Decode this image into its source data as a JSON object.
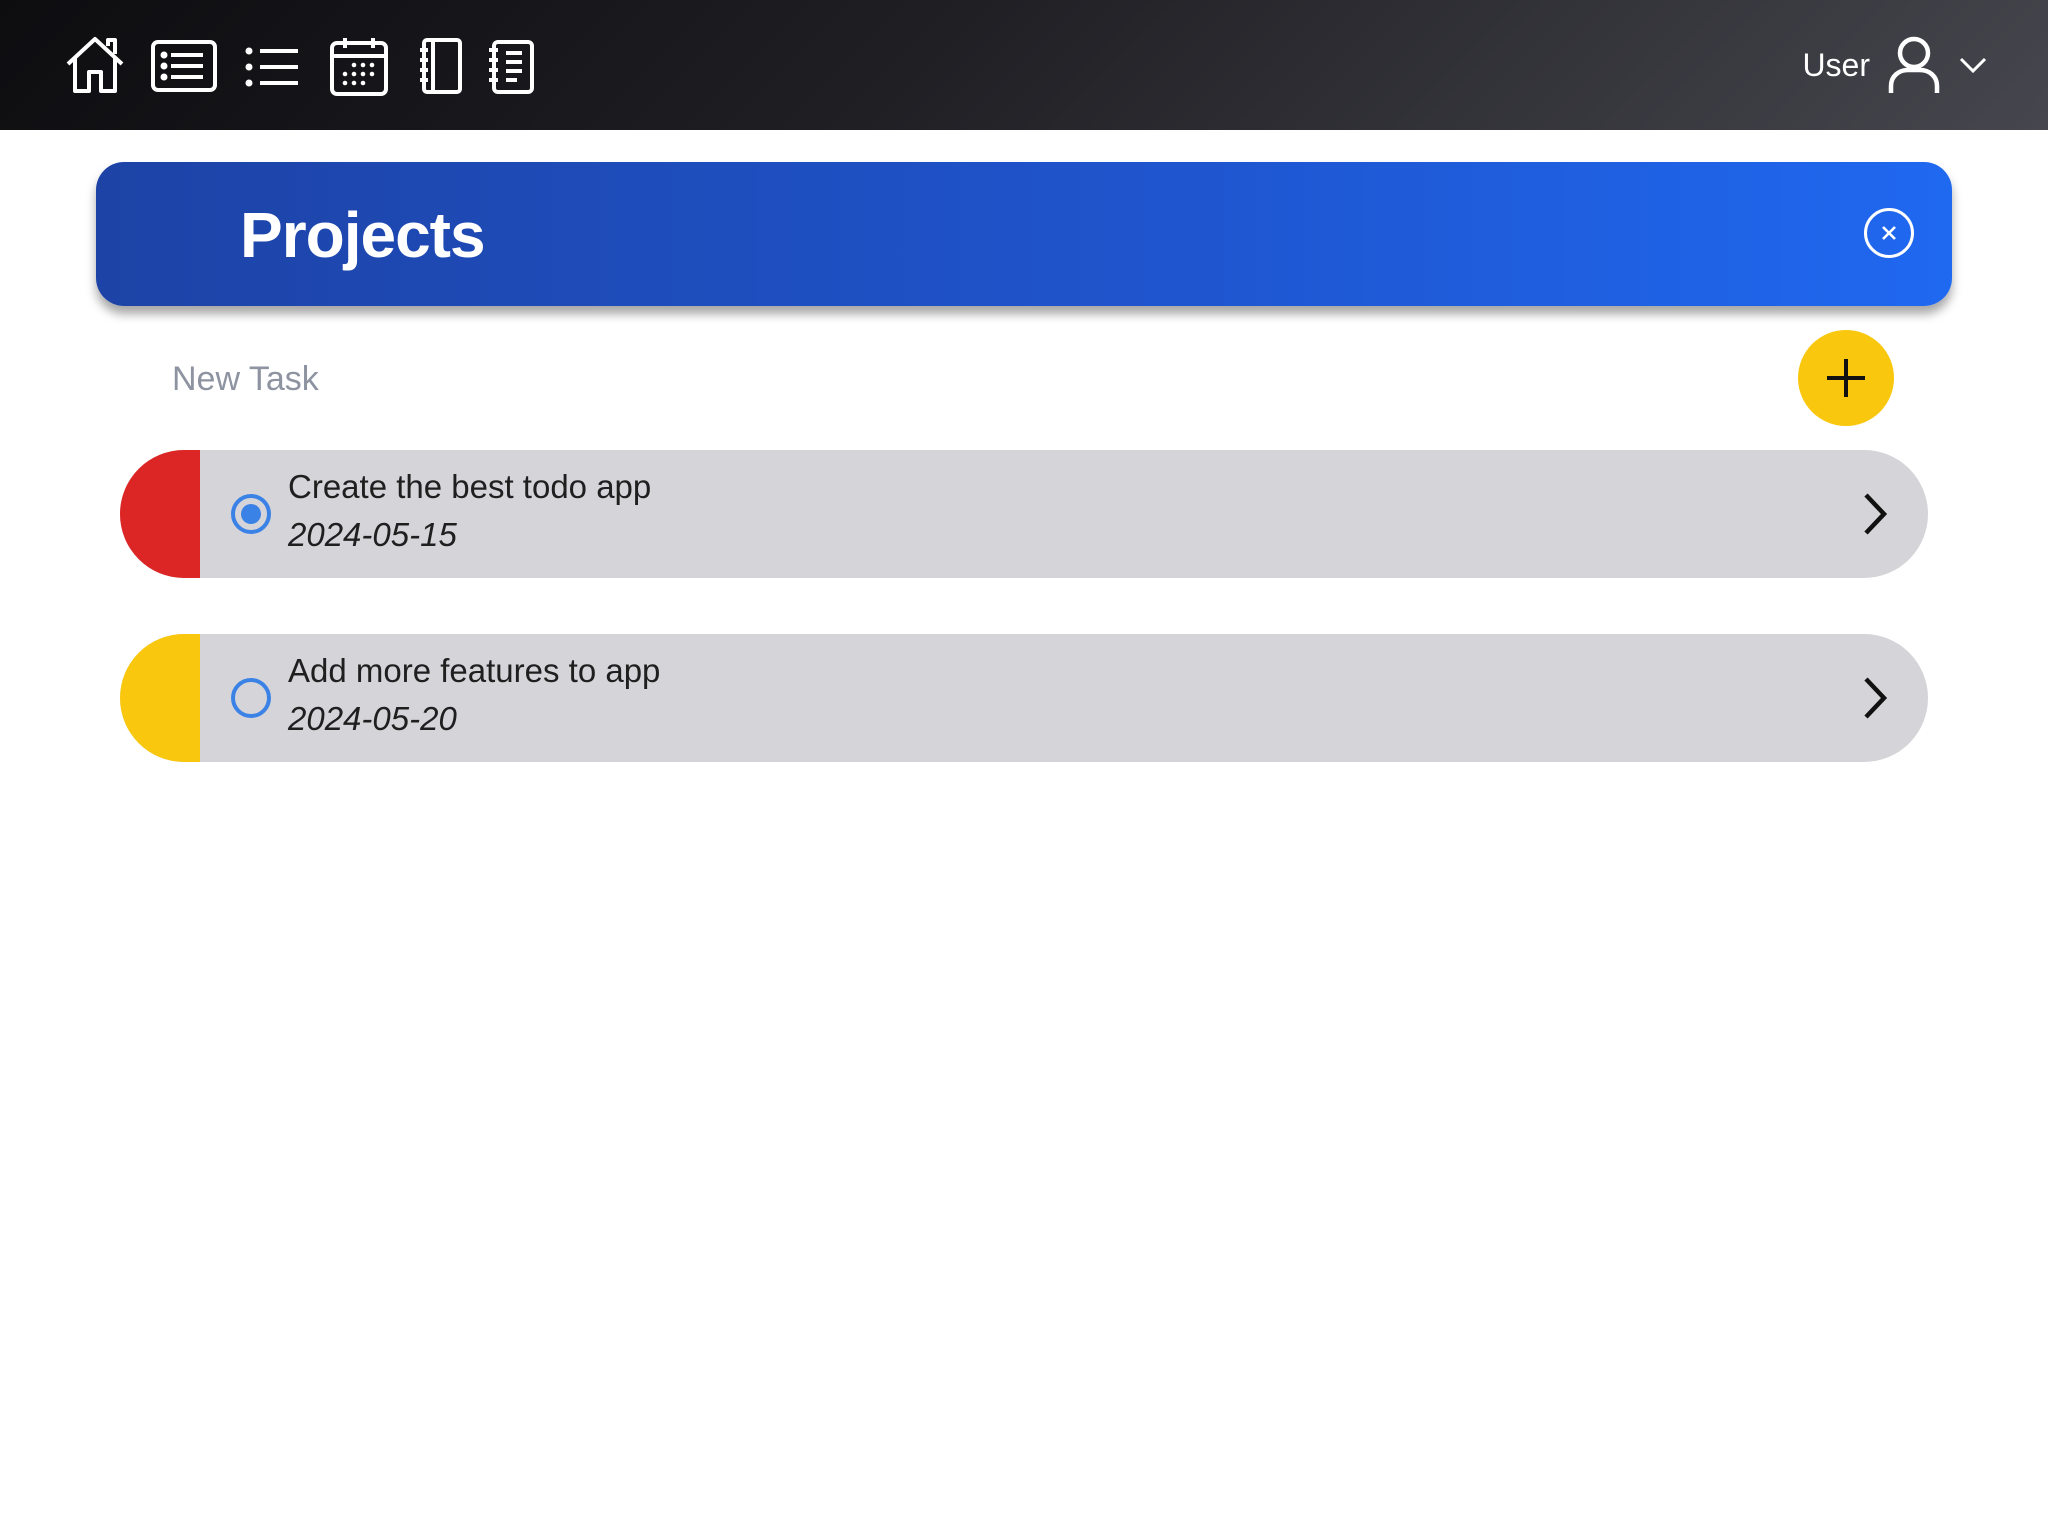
{
  "nav": {
    "icons": [
      "home-icon",
      "list-box-icon",
      "bullet-list-icon",
      "calendar-icon",
      "notebook-icon",
      "notepad-icon"
    ]
  },
  "user": {
    "label": "User",
    "icon": "user-icon",
    "menu_icon": "chevron-down-icon"
  },
  "header": {
    "title": "Projects",
    "close_icon": "close-icon"
  },
  "new_task": {
    "placeholder": "New Task",
    "value": "",
    "add_icon": "plus-icon"
  },
  "tasks": [
    {
      "title": "Create the best todo app",
      "date": "2024-05-15",
      "priority_color": "#dc2626",
      "selected": true
    },
    {
      "title": "Add more features to app",
      "date": "2024-05-20",
      "priority_color": "#f9c80e",
      "selected": false
    }
  ],
  "colors": {
    "accent_blue": "#1f54cc",
    "add_button": "#f9c80e",
    "radio": "#3b82e6",
    "task_bg": "#d4d4d9"
  }
}
